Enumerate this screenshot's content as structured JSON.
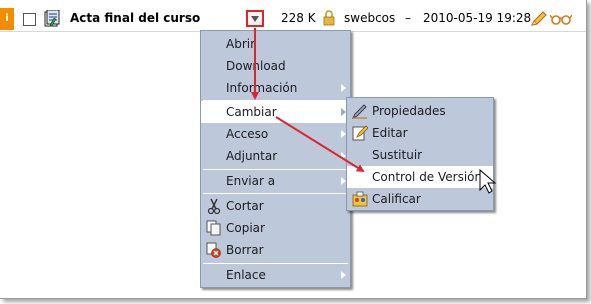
{
  "file_row": {
    "info_badge": "i",
    "file_name": "Acta final del curso",
    "size": "228 K",
    "owner": "swebcos",
    "date": "2010-05-19 19:28",
    "separator": "–"
  },
  "context_menu": {
    "items": [
      {
        "label": "Abrir"
      },
      {
        "label": "Download"
      },
      {
        "label": "Información"
      },
      {
        "label": "Cambiar"
      },
      {
        "label": "Acceso"
      },
      {
        "label": "Adjuntar"
      },
      {
        "label": "Enviar a"
      },
      {
        "label": "Cortar"
      },
      {
        "label": "Copiar"
      },
      {
        "label": "Borrar"
      },
      {
        "label": "Enlace"
      }
    ]
  },
  "submenu": {
    "items": [
      {
        "label": "Propiedades"
      },
      {
        "label": "Editar"
      },
      {
        "label": "Sustituir"
      },
      {
        "label": "Control de Versión"
      },
      {
        "label": "Calificar"
      }
    ]
  },
  "colors": {
    "menu_bg": "#bdc8db",
    "highlight": "#ffffff",
    "annotation_red": "#e0242a",
    "badge_orange": "#f28c00"
  }
}
